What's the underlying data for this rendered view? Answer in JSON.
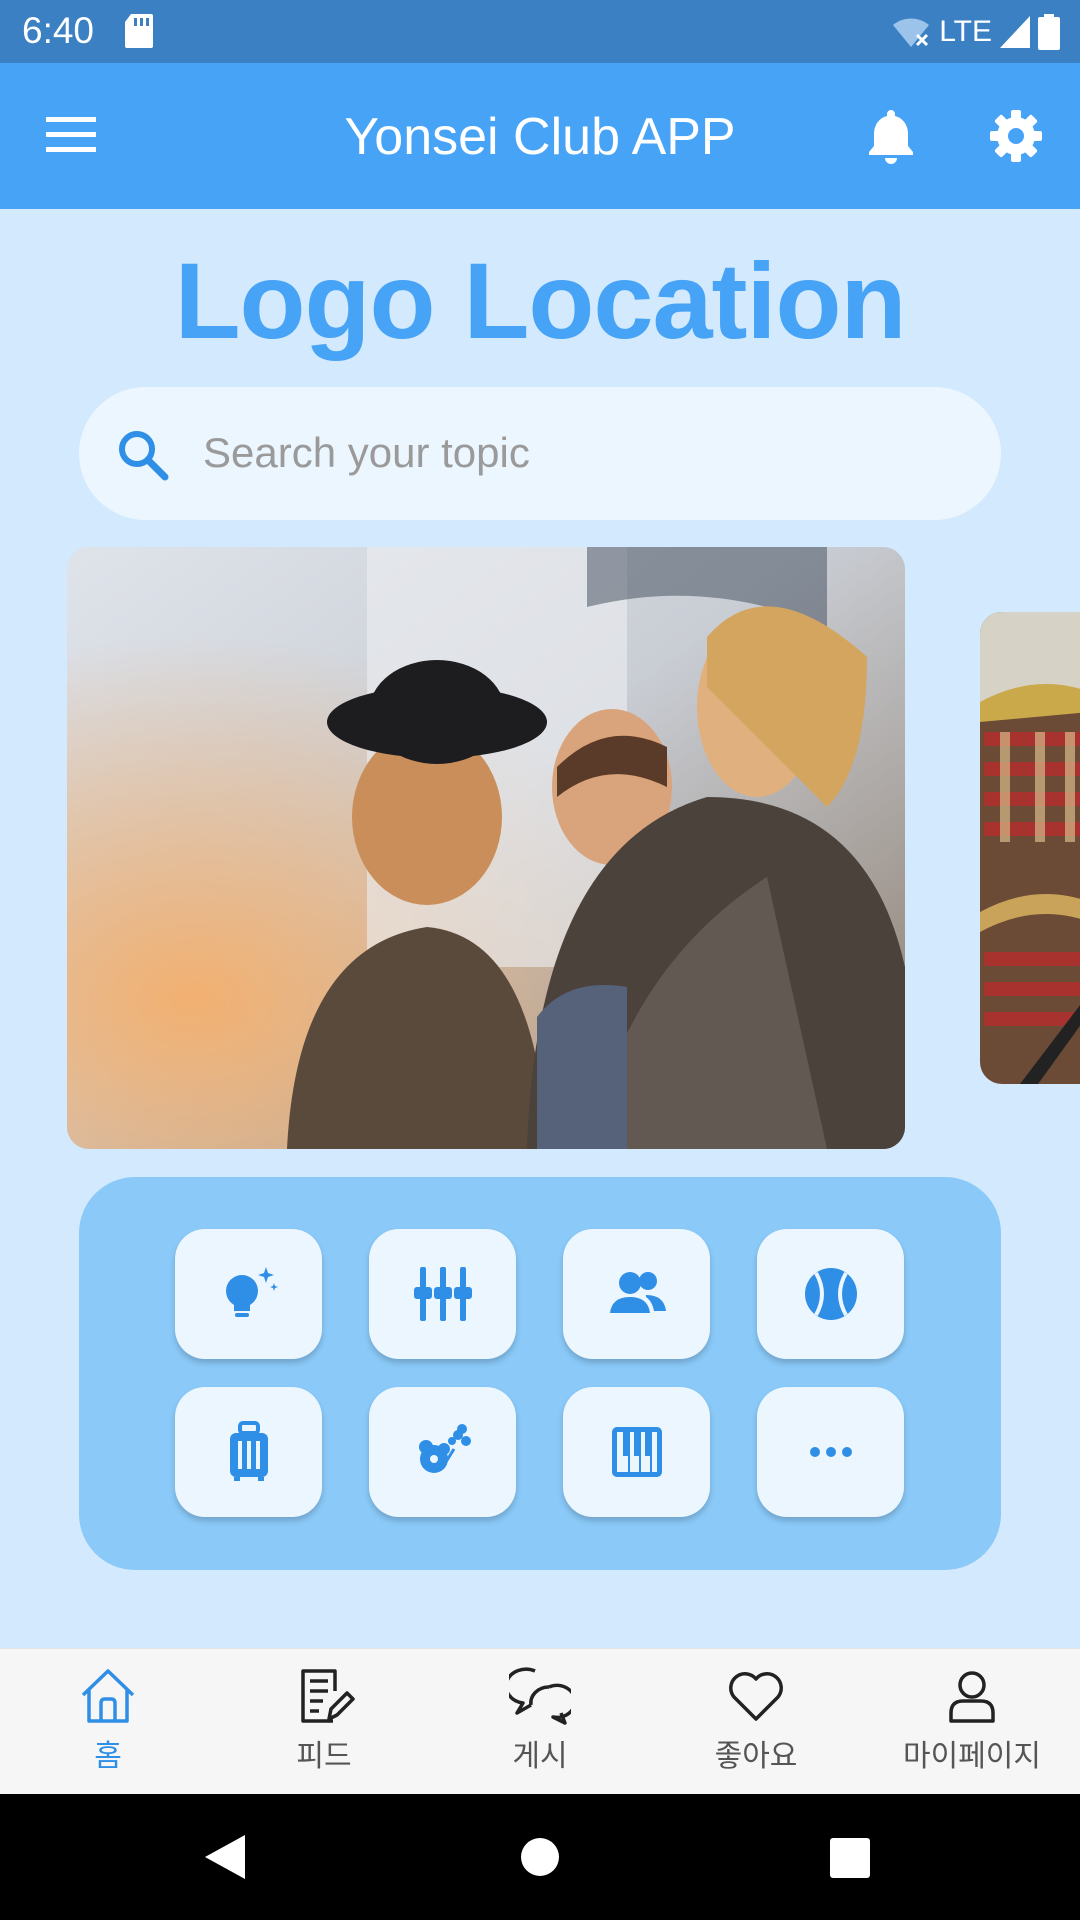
{
  "status_bar": {
    "time": "6:40",
    "network": "LTE",
    "icons": [
      "sd-card-icon",
      "wifi-off-icon",
      "signal-icon",
      "battery-icon"
    ]
  },
  "app_bar": {
    "title": "Yonsei Club APP",
    "icons": [
      "menu-icon",
      "bell-icon",
      "gear-icon"
    ]
  },
  "logo": {
    "text": "Logo Location"
  },
  "search": {
    "placeholder": "Search your topic",
    "value": ""
  },
  "carousel": {
    "slides": [
      "three-friends-laughing-photo",
      "library-bookshelves-photo"
    ]
  },
  "categories": [
    {
      "icon": "lightbulb-sparkle-icon"
    },
    {
      "icon": "equalizer-sliders-icon"
    },
    {
      "icon": "people-icon"
    },
    {
      "icon": "baseball-icon"
    },
    {
      "icon": "suitcase-icon"
    },
    {
      "icon": "flower-icon"
    },
    {
      "icon": "piano-keys-icon"
    },
    {
      "icon": "more-icon"
    }
  ],
  "bottom_nav": {
    "items": [
      {
        "label": "홈",
        "icon": "home-icon",
        "active": true
      },
      {
        "label": "피드",
        "icon": "document-edit-icon",
        "active": false
      },
      {
        "label": "게시",
        "icon": "chat-bubbles-icon",
        "active": false
      },
      {
        "label": "좋아요",
        "icon": "heart-icon",
        "active": false
      },
      {
        "label": "마이페이지",
        "icon": "user-icon",
        "active": false
      }
    ]
  },
  "colors": {
    "primary": "#46a3f6",
    "background": "#d3e9fd",
    "panel": "#8ac9f8",
    "tile": "#ecf6ff",
    "icon": "#2f8ee5"
  }
}
